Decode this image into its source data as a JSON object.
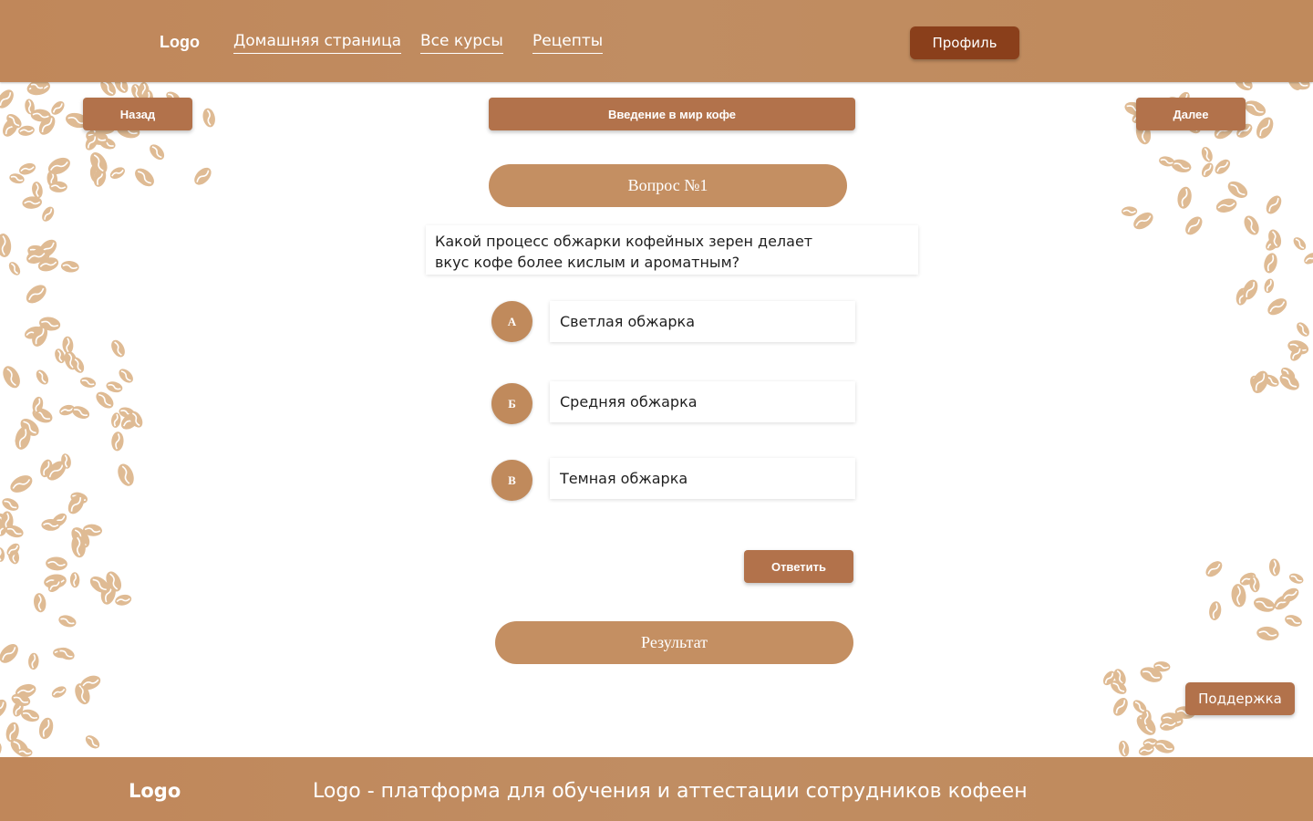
{
  "header": {
    "logo": "Logo",
    "nav": [
      "Домашняя страница",
      "Все курсы",
      "Рецепты"
    ],
    "profile_label": "Профиль"
  },
  "lesson": {
    "back_label": "Назад",
    "title": "Введение в мир кофе",
    "next_label": "Далее"
  },
  "quiz": {
    "question_number": "Вопрос №1",
    "question_text": "Какой процесс обжарки кофейных зерен делает\nвкус кофе более кислым и ароматным?",
    "options": [
      {
        "letter": "А",
        "text": "Светлая обжарка"
      },
      {
        "letter": "Б",
        "text": "Средняя обжарка"
      },
      {
        "letter": "В",
        "text": "Темная обжарка"
      }
    ],
    "answer_label": "Ответить",
    "result_label": "Результат"
  },
  "support_label": "Поддержка",
  "footer": {
    "logo": "Logo",
    "tagline": "Logo - платформа для обучения и аттестации сотрудников кофеен"
  },
  "colors": {
    "header_bg": "#c08a5c",
    "profile_button": "#8a3f1b",
    "button": "#b2724b",
    "pill": "#c48f62",
    "bean": "#dfbb94"
  },
  "decor": {
    "background_icon": "coffee-bean-icon"
  }
}
